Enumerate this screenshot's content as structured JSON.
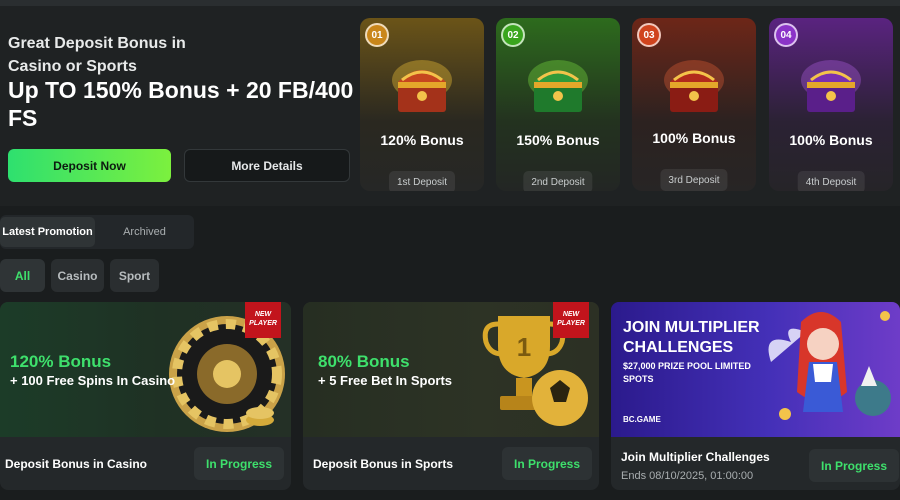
{
  "hero": {
    "subtitle": "Great Deposit Bonus in Casino or Sports",
    "title": "Up TO 150% Bonus + 20 FB/400 FS",
    "deposit_button": "Deposit Now",
    "details_button": "More Details"
  },
  "deposit_cards": [
    {
      "number": "01",
      "bonus": "120% Bonus",
      "label": "1st Deposit",
      "accent": "#e0a21c"
    },
    {
      "number": "02",
      "bonus": "150% Bonus",
      "label": "2nd Deposit",
      "accent": "#3fc21e"
    },
    {
      "number": "03",
      "bonus": "100% Bonus",
      "label": "3rd Deposit",
      "accent": "#e2431e"
    },
    {
      "number": "04",
      "bonus": "100% Bonus",
      "label": "4th Deposit",
      "accent": "#9b3fd6"
    }
  ],
  "tabs": {
    "active": "Latest Promotion",
    "archived": "Archived"
  },
  "filters": [
    "All",
    "Casino",
    "Sport"
  ],
  "promotions": [
    {
      "headline": "120% Bonus",
      "subline": "+ 100 Free Spins In Casino",
      "new_tag": "NEW PLAYER",
      "title": "Deposit Bonus in Casino",
      "status": "In Progress"
    },
    {
      "headline": "80% Bonus",
      "subline": "+ 5 Free Bet In Sports",
      "new_tag": "NEW PLAYER",
      "title": "Deposit Bonus in Sports",
      "status": "In Progress"
    },
    {
      "banner_title": "JOIN MULTIPLIER CHALLENGES",
      "banner_sub": "$27,000 PRIZE POOL LIMITED SPOTS",
      "banner_logo": "BC.GAME",
      "title": "Join Multiplier Challenges",
      "date": "Ends 08/10/2025, 01:00:00",
      "status": "In Progress"
    }
  ],
  "colors": {
    "accent_green": "#3ee06c",
    "background": "#1a1d1e"
  }
}
